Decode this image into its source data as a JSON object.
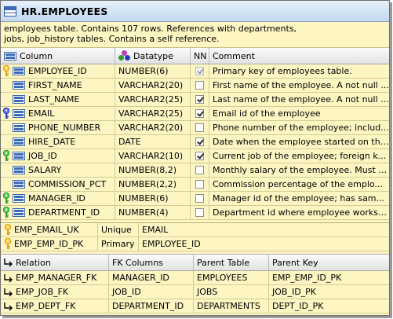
{
  "window": {
    "title": "HR.EMPLOYEES",
    "description": "employees table. Contains 107 rows. References with departments,\njobs, job_history tables. Contains a self reference."
  },
  "columns_table": {
    "headers": {
      "column": "Column",
      "datatype": "Datatype",
      "nn": "NN",
      "comment": "Comment"
    },
    "rows": [
      {
        "key": "primary",
        "name": "EMPLOYEE_ID",
        "type": "NUMBER(6)",
        "nn": true,
        "nn_disabled": true,
        "comment": "Primary key of employees table."
      },
      {
        "key": "",
        "name": "FIRST_NAME",
        "type": "VARCHAR2(20)",
        "nn": false,
        "comment": "First name of the employee. A not null ..."
      },
      {
        "key": "",
        "name": "LAST_NAME",
        "type": "VARCHAR2(25)",
        "nn": true,
        "comment": "Last name of the employee. A not null ..."
      },
      {
        "key": "unique",
        "name": "EMAIL",
        "type": "VARCHAR2(25)",
        "nn": true,
        "comment": "Email id of the employee"
      },
      {
        "key": "",
        "name": "PHONE_NUMBER",
        "type": "VARCHAR2(20)",
        "nn": false,
        "comment": "Phone number of the employee; includ..."
      },
      {
        "key": "",
        "name": "HIRE_DATE",
        "type": "DATE",
        "nn": true,
        "comment": "Date when the employee started on thi..."
      },
      {
        "key": "foreign",
        "name": "JOB_ID",
        "type": "VARCHAR2(10)",
        "nn": true,
        "comment": "Current job of the employee; foreign ke..."
      },
      {
        "key": "",
        "name": "SALARY",
        "type": "NUMBER(8,2)",
        "nn": false,
        "comment": "Monthly salary of the employee. Must b..."
      },
      {
        "key": "",
        "name": "COMMISSION_PCT",
        "type": "NUMBER(2,2)",
        "nn": false,
        "comment": "Commission percentage of the emplo..."
      },
      {
        "key": "foreign",
        "name": "MANAGER_ID",
        "type": "NUMBER(6)",
        "nn": false,
        "comment": "Manager id of the employee; has sam..."
      },
      {
        "key": "foreign",
        "name": "DEPARTMENT_ID",
        "type": "NUMBER(4)",
        "nn": false,
        "comment": "Department id where employee works;..."
      }
    ]
  },
  "indexes": [
    {
      "name": "EMP_EMAIL_UK",
      "type": "Unique",
      "columns": "EMAIL"
    },
    {
      "name": "EMP_EMP_ID_PK",
      "type": "Primary",
      "columns": "EMPLOYEE_ID"
    }
  ],
  "relations_table": {
    "headers": {
      "relation": "Relation",
      "fk_columns": "FK Columns",
      "parent_table": "Parent Table",
      "parent_key": "Parent Key"
    },
    "rows": [
      {
        "name": "EMP_MANAGER_FK",
        "fk_columns": "MANAGER_ID",
        "parent_table": "EMPLOYEES",
        "parent_key": "EMP_EMP_ID_PK"
      },
      {
        "name": "EMP_JOB_FK",
        "fk_columns": "JOB_ID",
        "parent_table": "JOBS",
        "parent_key": "JOB_ID_PK"
      },
      {
        "name": "EMP_DEPT_FK",
        "fk_columns": "DEPARTMENT_ID",
        "parent_table": "DEPARTMENTS",
        "parent_key": "DEPT_ID_PK"
      }
    ]
  },
  "colors": {
    "background": "#fdf6c3",
    "primary_key": "#e0a21c",
    "unique_key": "#2a3bbf",
    "foreign_key": "#2e9b2e",
    "column_icon": "#3d6db7"
  },
  "icons": {
    "table": "table-icon",
    "column": "column-icon",
    "datatype": "datatype-icon",
    "primary_key": "primary-key-icon",
    "unique_key": "unique-key-icon",
    "foreign_key": "foreign-key-icon",
    "relation": "relation-icon"
  }
}
